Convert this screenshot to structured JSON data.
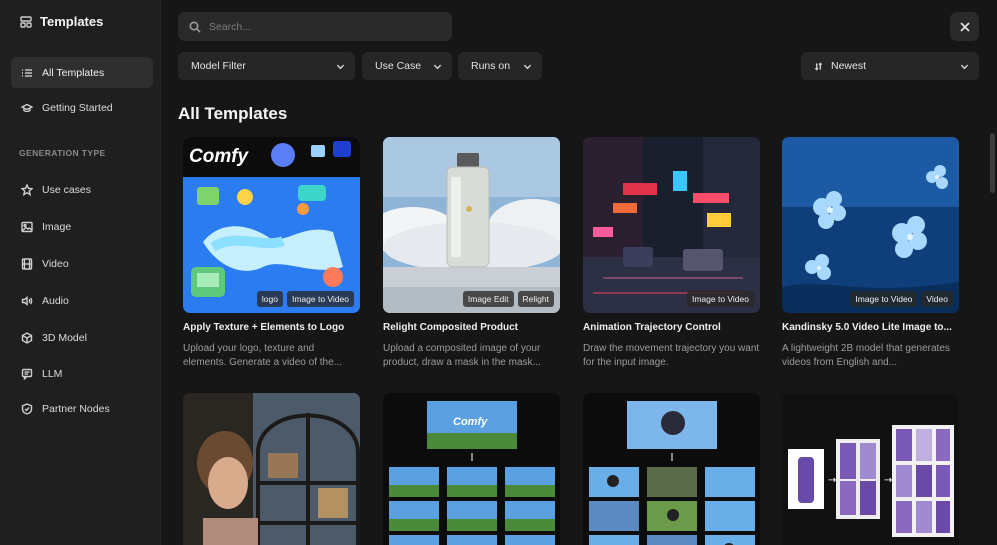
{
  "sidebar": {
    "title": "Templates",
    "items": [
      {
        "label": "All Templates",
        "icon": "list-icon",
        "active": true
      },
      {
        "label": "Getting Started",
        "icon": "graduation-cap-icon"
      }
    ],
    "section_label": "GENERATION TYPE",
    "types": [
      {
        "label": "Use cases",
        "icon": "star-icon"
      },
      {
        "label": "Image",
        "icon": "image-icon"
      },
      {
        "label": "Video",
        "icon": "film-icon"
      },
      {
        "label": "Audio",
        "icon": "speaker-icon"
      },
      {
        "label": "3D Model",
        "icon": "cube-icon"
      },
      {
        "label": "LLM",
        "icon": "chat-icon"
      },
      {
        "label": "Partner Nodes",
        "icon": "badge-icon"
      }
    ]
  },
  "search": {
    "placeholder": "Search..."
  },
  "filters": {
    "model": "Model Filter",
    "use_case": "Use Case",
    "runs_on": "Runs on",
    "sort": "Newest"
  },
  "heading": "All Templates",
  "cards": [
    {
      "title": "Apply Texture + Elements to Logo",
      "description": "Upload your logo, texture and elements. Generate a video of the...",
      "tags": [
        "logo",
        "Image to Video"
      ],
      "thumb_text": "Comfy"
    },
    {
      "title": "Relight Composited Product",
      "description": "Upload a composited image of your product, draw a mask in the mask...",
      "tags": [
        "Image Edit",
        "Relight"
      ]
    },
    {
      "title": "Animation Trajectory Control",
      "description": "Draw the movement trajectory you want for the input image.",
      "tags": [
        "Image to Video"
      ]
    },
    {
      "title": "Kandinsky 5.0 Video Lite Image to...",
      "description": "A lightweight 2B model that generates videos from English and...",
      "tags": [
        "Image to Video",
        "Video"
      ]
    },
    {
      "title": "",
      "description": "",
      "tags": []
    },
    {
      "title": "",
      "description": "",
      "tags": []
    },
    {
      "title": "",
      "description": "",
      "tags": []
    },
    {
      "title": "",
      "description": "",
      "tags": []
    }
  ],
  "colors": {
    "sidebar_bg": "#1f1f1f",
    "main_bg": "#161616",
    "control_bg": "#2a2a2a",
    "active_bg": "#2f2f2f"
  }
}
